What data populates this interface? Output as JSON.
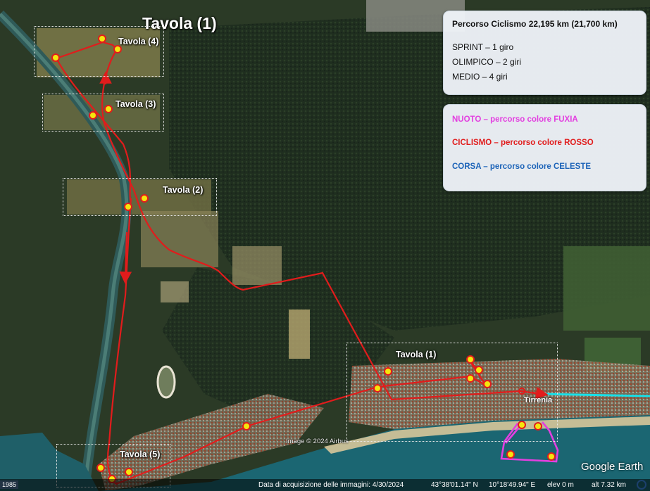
{
  "title": "Tavola (1)",
  "boxes": [
    {
      "label": "Tavola (4)"
    },
    {
      "label": "Tavola (3)"
    },
    {
      "label": "Tavola (2)"
    },
    {
      "label": "Tavola (1)"
    },
    {
      "label": "Tavola (5)"
    }
  ],
  "info_panel": {
    "heading": "Percorso Ciclismo 22,195 km (21,700 km)",
    "lines": [
      "SPRINT – 1 giro",
      "OLIMPICO – 2 giri",
      "MEDIO – 4 giri"
    ]
  },
  "legend_panel": {
    "items": [
      {
        "text": "NUOTO – percorso colore FUXIA",
        "color": "#e33fe0"
      },
      {
        "text": "CICLISMO – percorso colore ROSSO",
        "color": "#e11c1c"
      },
      {
        "text": "CORSA – percorso colore CELESTE",
        "color": "#1c63b8"
      }
    ]
  },
  "town_label": "Tirrenia",
  "watermark": "Image © 2024 Airbus",
  "brand": "Google Earth",
  "footer": {
    "year": "1985",
    "acquisition": "Data di acquisizione delle immagini: 4/30/2024",
    "lat": "43°38'01.14\" N",
    "lon": "10°18'49.94\" E",
    "elev": "elev   0 m",
    "alt": "alt  7.32 km"
  },
  "route_colors": {
    "swim": "#e33fe0",
    "bike": "#e11c1c",
    "run": "#18e0e8"
  },
  "icons": [
    "marker-icon",
    "arrow-icon",
    "compass-icon"
  ]
}
